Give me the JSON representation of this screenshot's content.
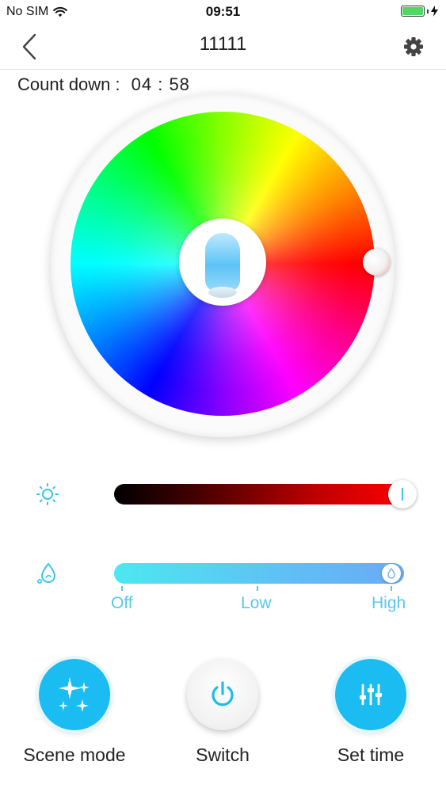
{
  "status_bar": {
    "carrier": "No SIM",
    "time": "09:51",
    "wifi_icon": "wifi-icon",
    "battery_icon": "battery-charging-icon"
  },
  "nav": {
    "title": "11111",
    "back_icon": "chevron-left-icon",
    "settings_icon": "gear-icon"
  },
  "countdown": {
    "label": "Count down :",
    "value": "04 : 58"
  },
  "color_wheel": {
    "center_icon": "lamp-icon",
    "selected_color": "#ff0000"
  },
  "brightness": {
    "icon": "sun-icon",
    "level": 1.0,
    "color": "#ff0000"
  },
  "humidifier": {
    "icon": "water-drop-icon",
    "levels": [
      "Off",
      "Low",
      "High"
    ],
    "selected": "High",
    "accent": "#56c9ee"
  },
  "actions": {
    "scene": {
      "label": "Scene mode",
      "icon": "sparkles-icon"
    },
    "switch": {
      "label": "Switch",
      "icon": "power-icon"
    },
    "set_time": {
      "label": "Set time",
      "icon": "sliders-icon"
    }
  },
  "colors": {
    "accent": "#1bbcf1",
    "text": "#222222"
  }
}
